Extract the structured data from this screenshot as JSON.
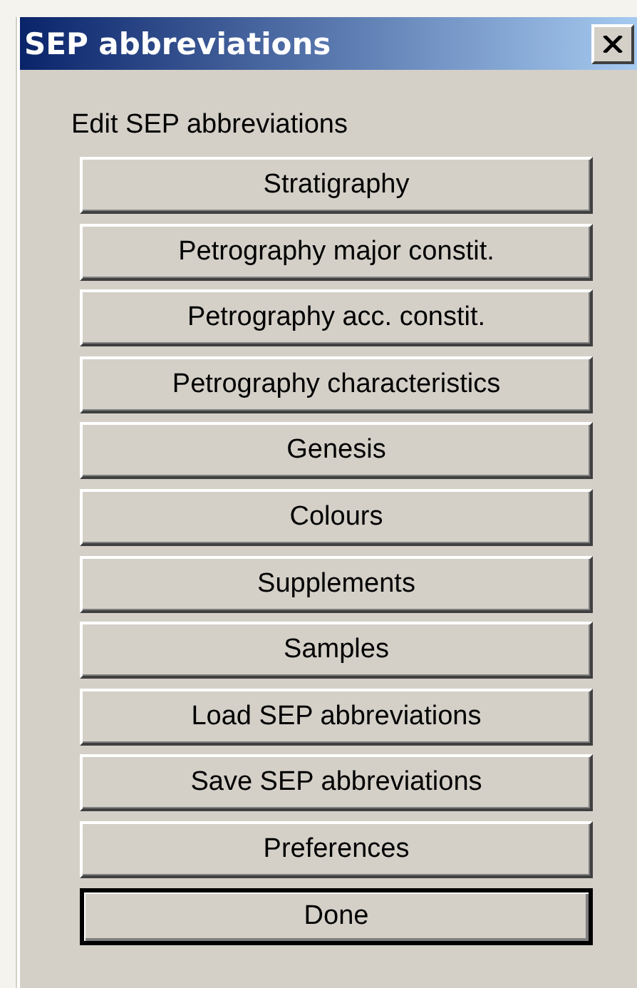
{
  "window": {
    "title": "SEP abbreviations"
  },
  "heading": "Edit SEP abbreviations",
  "buttons": [
    {
      "label": "Stratigraphy",
      "default": false
    },
    {
      "label": "Petrography major constit.",
      "default": false
    },
    {
      "label": "Petrography acc. constit.",
      "default": false
    },
    {
      "label": "Petrography characteristics",
      "default": false
    },
    {
      "label": "Genesis",
      "default": false
    },
    {
      "label": "Colours",
      "default": false
    },
    {
      "label": "Supplements",
      "default": false
    },
    {
      "label": "Samples",
      "default": false
    },
    {
      "label": "Load SEP abbreviations",
      "default": false
    },
    {
      "label": "Save SEP abbreviations",
      "default": false
    },
    {
      "label": "Preferences",
      "default": false
    },
    {
      "label": "Done",
      "default": true
    }
  ]
}
